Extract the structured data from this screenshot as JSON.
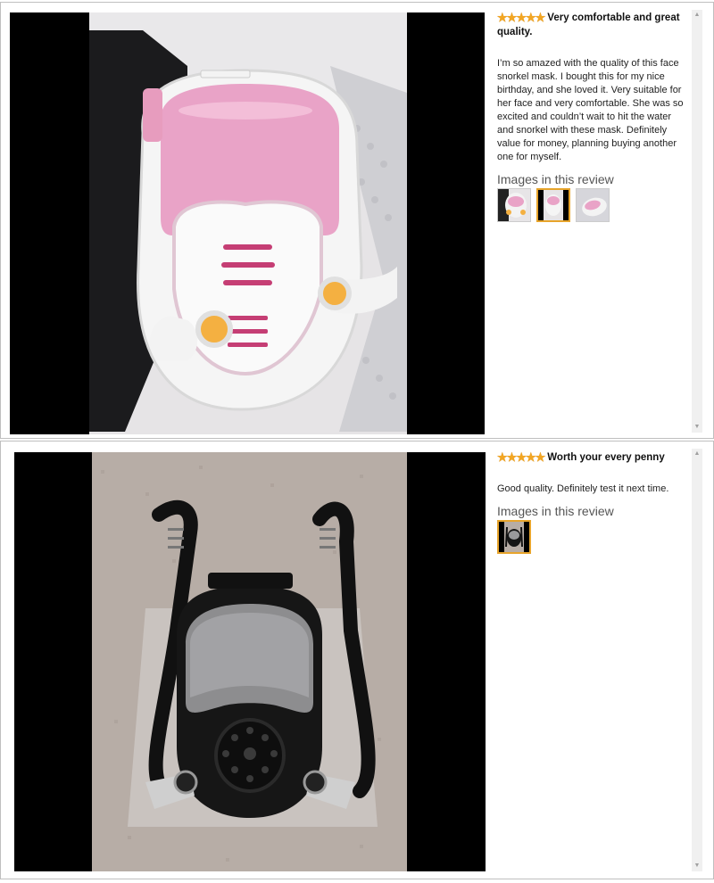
{
  "reviews": [
    {
      "rating": 5,
      "title": "Very comfortable and great quality.",
      "body": "I’m so amazed with the quality of this face snorkel mask. I bought this for my nice birthday, and she loved it. Very suitable for her face and very comfortable. She was so excited and couldn’t wait to hit the water and snorkel with these mask. Definitely value for money, planning buying another one for myself.",
      "images_heading": "Images in this review",
      "thumbnail_count": 3,
      "selected_thumbnail": 2
    },
    {
      "rating": 5,
      "title": "Worth your every penny",
      "body": "Good quality. Definitely test it next time.",
      "images_heading": "Images in this review",
      "thumbnail_count": 1,
      "selected_thumbnail": 1
    }
  ],
  "icons": {
    "star": "star-icon",
    "scroll_up": "scroll-up-arrow-icon",
    "scroll_down": "scroll-down-arrow-icon"
  },
  "colors": {
    "star": "#f3a623",
    "selected_border": "#e7a42b",
    "mask_pink": "#e9a3c7",
    "mask_black": "#1a1a1a"
  }
}
